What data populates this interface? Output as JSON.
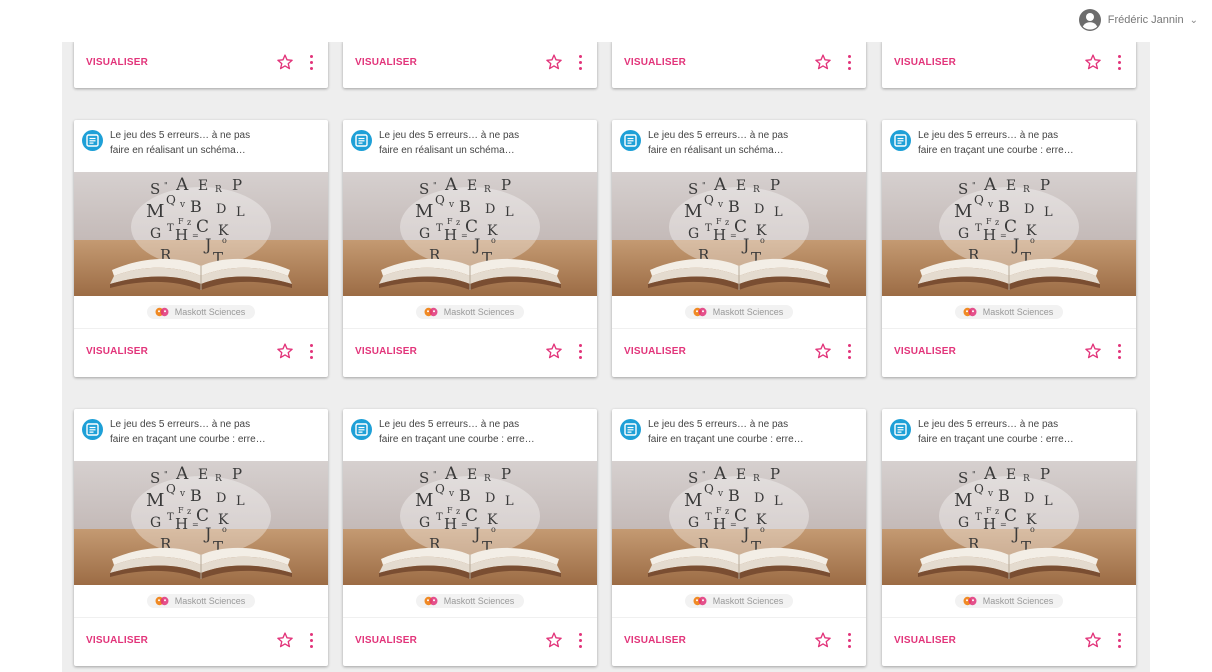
{
  "user": {
    "name": "Frédéric Jannin",
    "avatar_icon": "account-circle-icon",
    "menu_icon": "chevron-down-icon"
  },
  "theme": {
    "accent": "#e2347a",
    "resource_icon_bg": "#1ea0d7",
    "background": "#eeeeee"
  },
  "cards": {
    "top_row": [
      {
        "action_label": "VISUALISER"
      },
      {
        "action_label": "VISUALISER"
      },
      {
        "action_label": "VISUALISER"
      },
      {
        "action_label": "VISUALISER"
      }
    ],
    "row2": [
      {
        "title_line1": "Le jeu des 5 erreurs… à ne pas",
        "title_line2": "faire en réalisant un schéma…",
        "tag": "Maskott Sciences",
        "action_label": "VISUALISER"
      },
      {
        "title_line1": "Le jeu des 5 erreurs… à ne pas",
        "title_line2": "faire en réalisant un schéma…",
        "tag": "Maskott Sciences",
        "action_label": "VISUALISER"
      },
      {
        "title_line1": "Le jeu des 5 erreurs… à ne pas",
        "title_line2": "faire en réalisant un schéma…",
        "tag": "Maskott Sciences",
        "action_label": "VISUALISER"
      },
      {
        "title_line1": "Le jeu des 5 erreurs… à ne pas",
        "title_line2": "faire en traçant une courbe : erre…",
        "tag": "Maskott Sciences",
        "action_label": "VISUALISER"
      }
    ],
    "row3": [
      {
        "title_line1": "Le jeu des 5 erreurs… à ne pas",
        "title_line2": "faire en traçant une courbe : erre…",
        "tag": "Maskott Sciences",
        "action_label": "VISUALISER"
      },
      {
        "title_line1": "Le jeu des 5 erreurs… à ne pas",
        "title_line2": "faire en traçant une courbe : erre…",
        "tag": "Maskott Sciences",
        "action_label": "VISUALISER"
      },
      {
        "title_line1": "Le jeu des 5 erreurs… à ne pas",
        "title_line2": "faire en traçant une courbe : erre…",
        "tag": "Maskott Sciences",
        "action_label": "VISUALISER"
      },
      {
        "title_line1": "Le jeu des 5 erreurs… à ne pas",
        "title_line2": "faire en traçant une courbe : erre…",
        "tag": "Maskott Sciences",
        "action_label": "VISUALISER"
      }
    ]
  }
}
